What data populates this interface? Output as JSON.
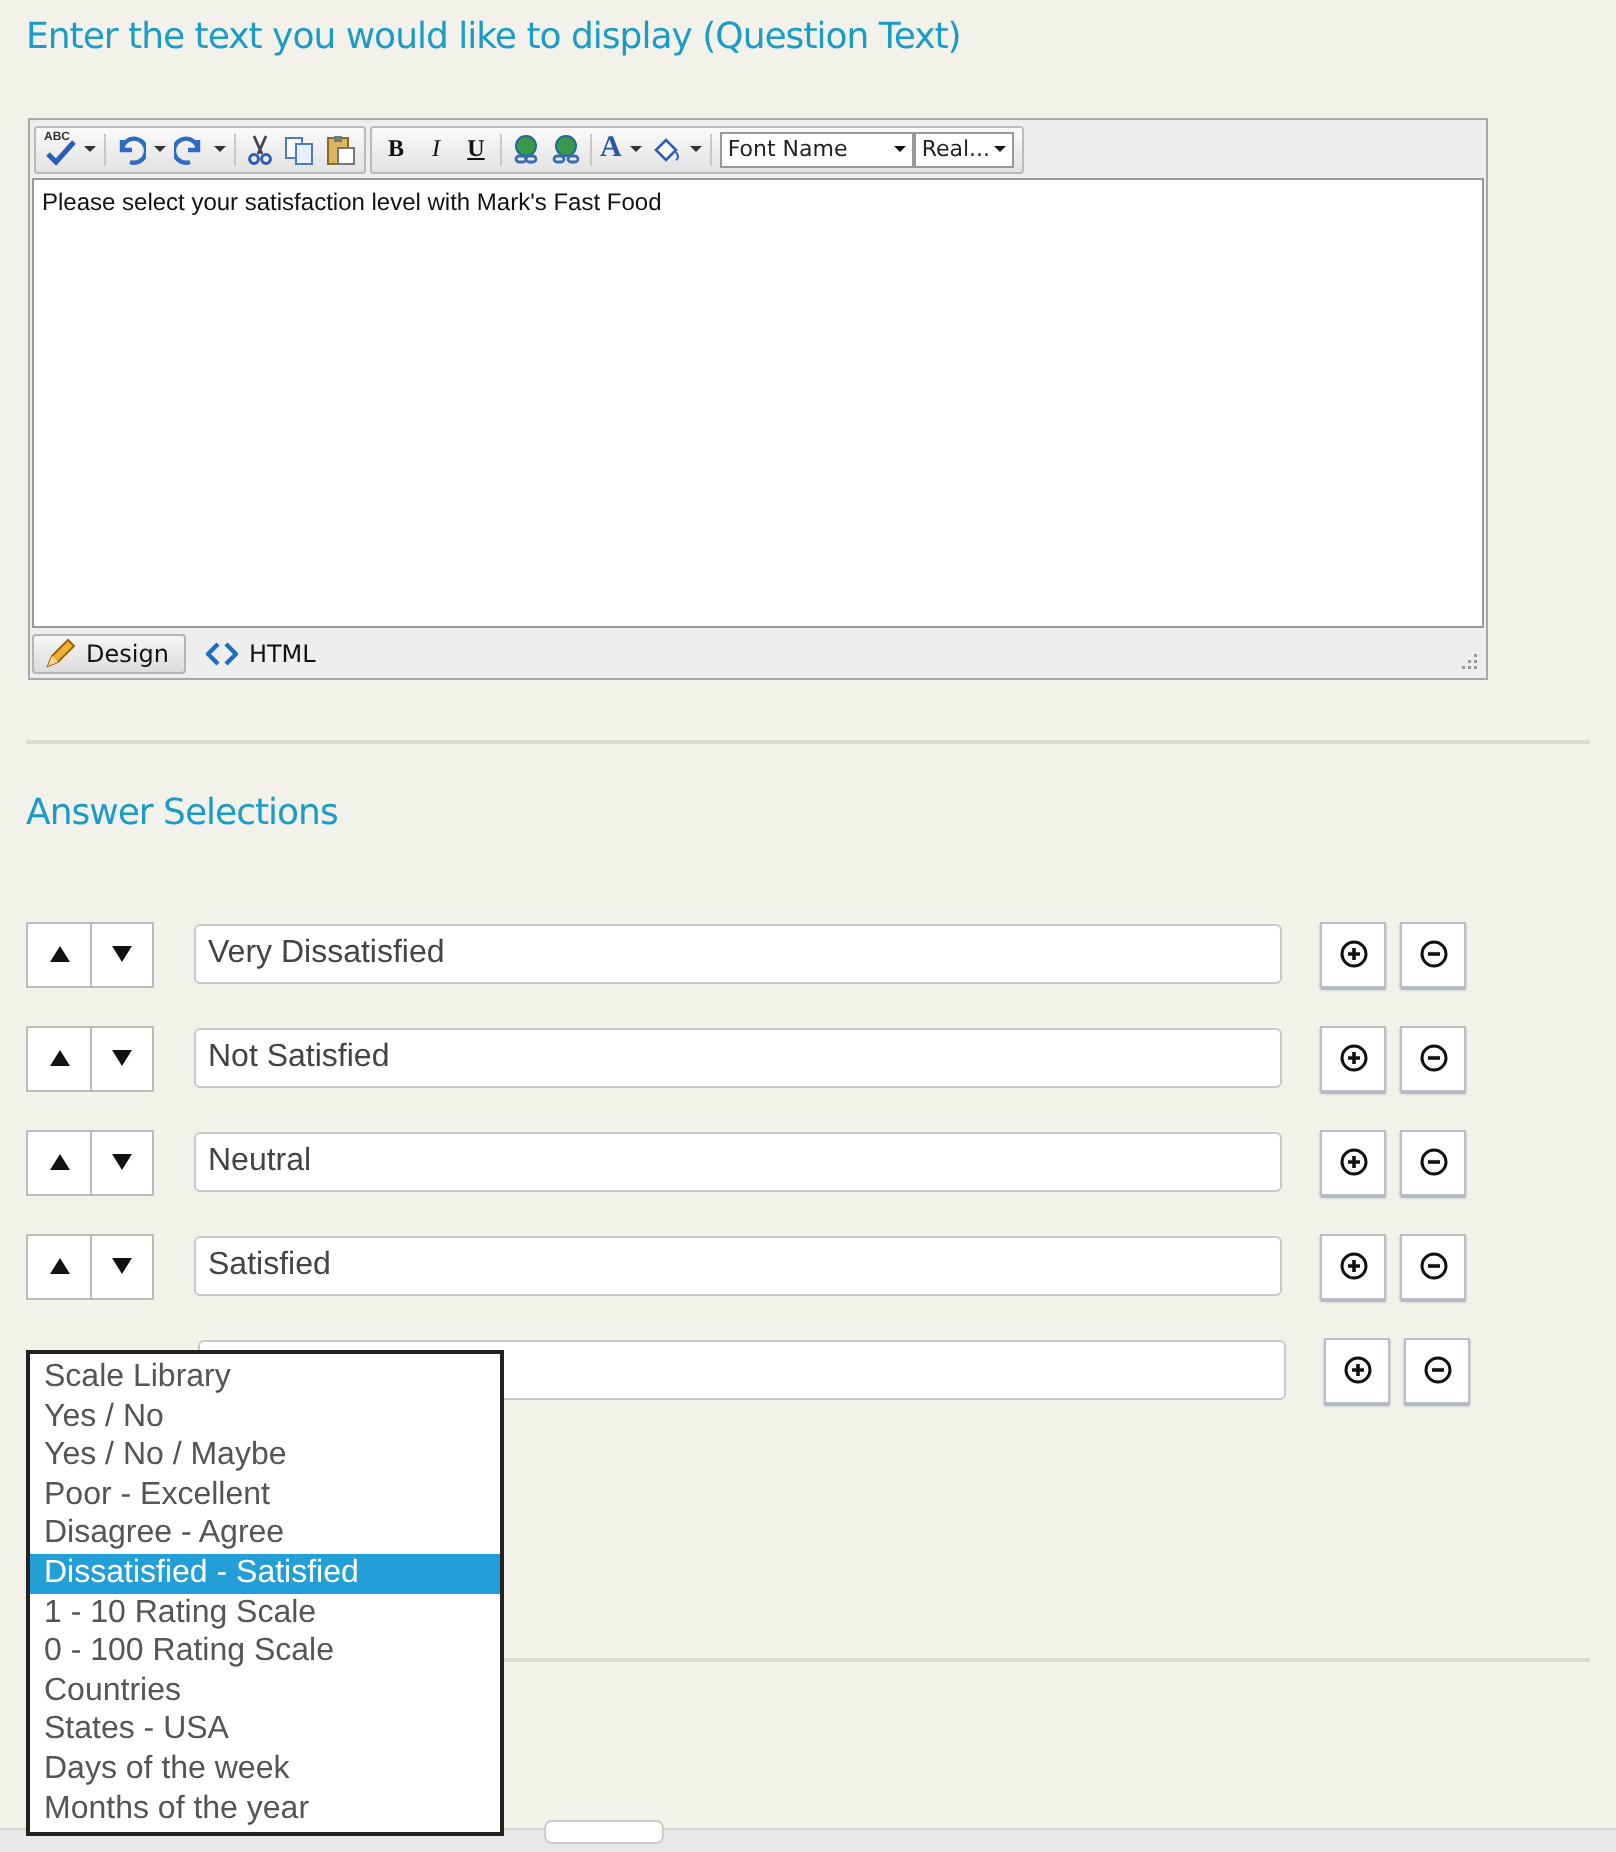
{
  "question_heading": "Enter the text you would like to display (Question Text)",
  "editor": {
    "toolbar": {
      "spell_label": "ABC",
      "format_buttons": [
        "B",
        "I",
        "U"
      ],
      "font_color_label": "A",
      "font_name": "Font Name",
      "font_size": "Real..."
    },
    "content": "Please select your satisfaction level with Mark's Fast Food",
    "modes": [
      {
        "label": "Design",
        "selected": true
      },
      {
        "label": "HTML",
        "selected": false
      }
    ]
  },
  "answers_heading": "Answer Selections",
  "answers": [
    {
      "value": "Very Dissatisfied"
    },
    {
      "value": "Not Satisfied"
    },
    {
      "value": "Neutral"
    },
    {
      "value": "Satisfied"
    }
  ],
  "blank_row": true,
  "scale_dropdown": {
    "options": [
      {
        "label": "Scale Library",
        "selected": false
      },
      {
        "label": "Yes / No",
        "selected": false
      },
      {
        "label": "Yes / No / Maybe",
        "selected": false
      },
      {
        "label": "Poor - Excellent",
        "selected": false
      },
      {
        "label": "Disagree - Agree",
        "selected": false
      },
      {
        "label": "Dissatisfied - Satisfied",
        "selected": true
      },
      {
        "label": "1 - 10 Rating Scale",
        "selected": false
      },
      {
        "label": "0 - 100 Rating Scale",
        "selected": false
      },
      {
        "label": "Countries",
        "selected": false
      },
      {
        "label": "States - USA",
        "selected": false
      },
      {
        "label": "Days of the week",
        "selected": false
      },
      {
        "label": "Months of the year",
        "selected": false
      }
    ]
  }
}
